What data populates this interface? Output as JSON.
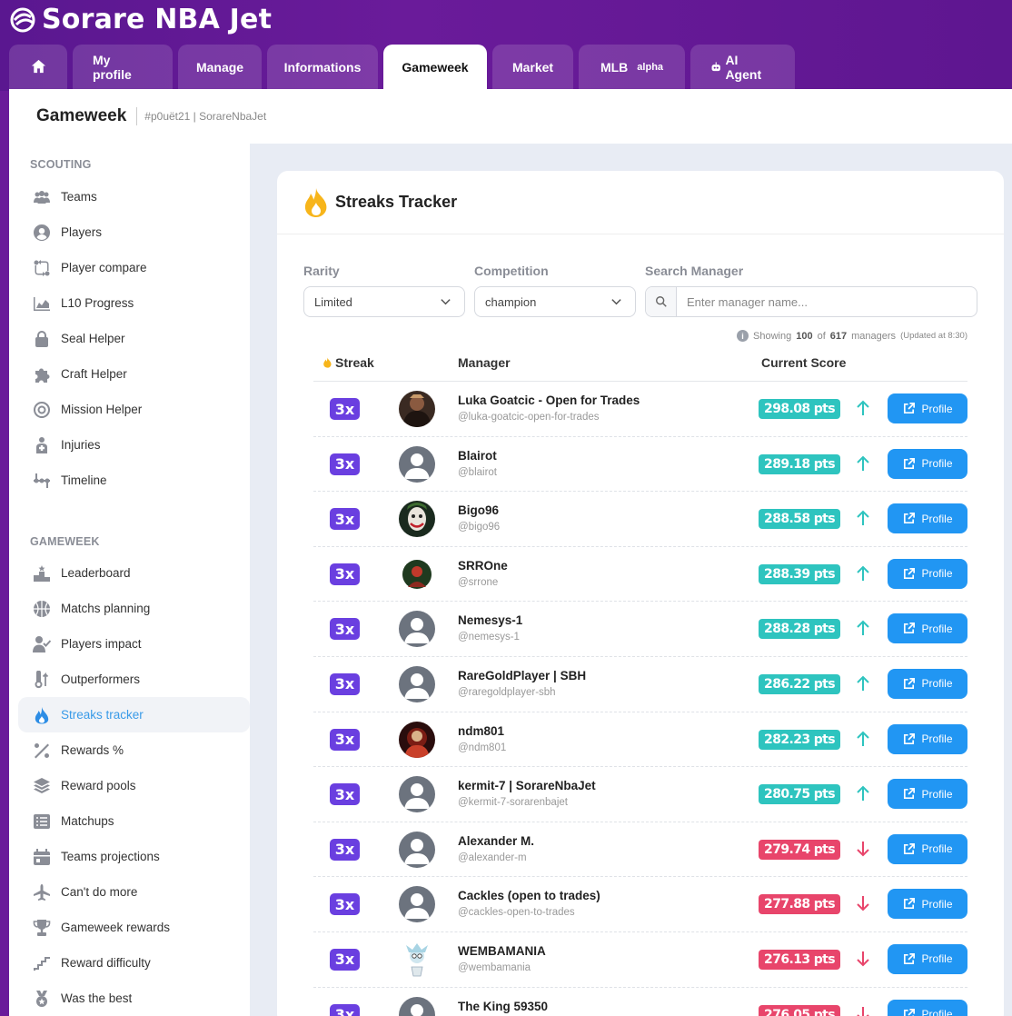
{
  "app": {
    "name": "Sorare NBA Jet"
  },
  "tabs": [
    {
      "label": "",
      "icon": "home-icon"
    },
    {
      "label": "My profile"
    },
    {
      "label": "Manage"
    },
    {
      "label": "Informations"
    },
    {
      "label": "Gameweek",
      "active": true
    },
    {
      "label": "Market"
    },
    {
      "label": "MLB",
      "badge": "alpha"
    },
    {
      "label": "AI Agent",
      "icon": "robot-icon"
    }
  ],
  "page": {
    "title": "Gameweek",
    "subtitle": "#p0uët21 | SorareNbaJet"
  },
  "sidebar": {
    "scouting_title": "SCOUTING",
    "scouting": [
      {
        "label": "Teams",
        "icon": "users-icon"
      },
      {
        "label": "Players",
        "icon": "user-circle-icon"
      },
      {
        "label": "Player compare",
        "icon": "compare-icon"
      },
      {
        "label": "L10 Progress",
        "icon": "area-chart-icon"
      },
      {
        "label": "Seal Helper",
        "icon": "lock-icon"
      },
      {
        "label": "Craft Helper",
        "icon": "puzzle-icon"
      },
      {
        "label": "Mission Helper",
        "icon": "target-icon"
      },
      {
        "label": "Injuries",
        "icon": "injury-icon"
      },
      {
        "label": "Timeline",
        "icon": "timeline-icon"
      }
    ],
    "gameweek_title": "GAMEWEEK",
    "gameweek": [
      {
        "label": "Leaderboard",
        "icon": "podium-icon"
      },
      {
        "label": "Matchs planning",
        "icon": "basketball-icon"
      },
      {
        "label": "Players impact",
        "icon": "user-check-icon"
      },
      {
        "label": "Outperformers",
        "icon": "thermometer-icon"
      },
      {
        "label": "Streaks tracker",
        "icon": "fire-icon",
        "active": true
      },
      {
        "label": "Rewards %",
        "icon": "percent-icon"
      },
      {
        "label": "Reward pools",
        "icon": "layers-icon"
      },
      {
        "label": "Matchups",
        "icon": "list-icon"
      },
      {
        "label": "Teams projections",
        "icon": "calendar-icon"
      },
      {
        "label": "Can't do more",
        "icon": "plane-icon"
      },
      {
        "label": "Gameweek rewards",
        "icon": "trophy-icon"
      },
      {
        "label": "Reward difficulty",
        "icon": "stairs-icon"
      },
      {
        "label": "Was the best",
        "icon": "medal-icon"
      }
    ]
  },
  "card": {
    "title": "Streaks Tracker"
  },
  "filters": {
    "rarity": {
      "label": "Rarity",
      "value": "Limited"
    },
    "competition": {
      "label": "Competition",
      "value": "champion"
    },
    "search": {
      "label": "Search Manager",
      "placeholder": "Enter manager name..."
    }
  },
  "info": {
    "prefix": "Showing",
    "shown": "100",
    "of": "of",
    "total": "617",
    "suffix": "managers",
    "updated": "(Updated at 8:30)"
  },
  "table": {
    "headers": {
      "streak": "Streak",
      "manager": "Manager",
      "score": "Current Score"
    },
    "profile_label": "Profile",
    "rows": [
      {
        "streak": "3x",
        "name": "Luka Goatcic - Open for Trades",
        "slug": "@luka-goatcic-open-for-trades",
        "score": "298.08 pts",
        "trend": "up",
        "avatar": "photo-dark"
      },
      {
        "streak": "3x",
        "name": "Blairot",
        "slug": "@blairot",
        "score": "289.18 pts",
        "trend": "up",
        "avatar": "default"
      },
      {
        "streak": "3x",
        "name": "Bigo96",
        "slug": "@bigo96",
        "score": "288.58 pts",
        "trend": "up",
        "avatar": "joker"
      },
      {
        "streak": "3x",
        "name": "SRROne",
        "slug": "@srrone",
        "score": "288.39 pts",
        "trend": "up",
        "avatar": "small-red"
      },
      {
        "streak": "3x",
        "name": "Nemesys-1",
        "slug": "@nemesys-1",
        "score": "288.28 pts",
        "trend": "up",
        "avatar": "default"
      },
      {
        "streak": "3x",
        "name": "RareGoldPlayer | SBH",
        "slug": "@raregoldplayer-sbh",
        "score": "286.22 pts",
        "trend": "up",
        "avatar": "default"
      },
      {
        "streak": "3x",
        "name": "ndm801",
        "slug": "@ndm801",
        "score": "282.23 pts",
        "trend": "up",
        "avatar": "photo-red"
      },
      {
        "streak": "3x",
        "name": "kermit-7 | SorareNbaJet",
        "slug": "@kermit-7-sorarenbajet",
        "score": "280.75 pts",
        "trend": "up",
        "avatar": "default"
      },
      {
        "streak": "3x",
        "name": "Alexander M.",
        "slug": "@alexander-m",
        "score": "279.74 pts",
        "trend": "down",
        "avatar": "default"
      },
      {
        "streak": "3x",
        "name": "Cackles (open to trades)",
        "slug": "@cackles-open-to-trades",
        "score": "277.88 pts",
        "trend": "down",
        "avatar": "default"
      },
      {
        "streak": "3x",
        "name": "WEMBAMANIA",
        "slug": "@wembamania",
        "score": "276.13 pts",
        "trend": "down",
        "avatar": "cartoon"
      },
      {
        "streak": "3x",
        "name": "The King 59350",
        "slug": "",
        "score": "276.05 pts",
        "trend": "down",
        "avatar": "default"
      }
    ]
  },
  "colors": {
    "purple": "#6a1b9a",
    "badge": "#6a3fe0",
    "up": "#2ec4bf",
    "down": "#e8456b",
    "button": "#2196f3",
    "active": "#2d8de5"
  }
}
